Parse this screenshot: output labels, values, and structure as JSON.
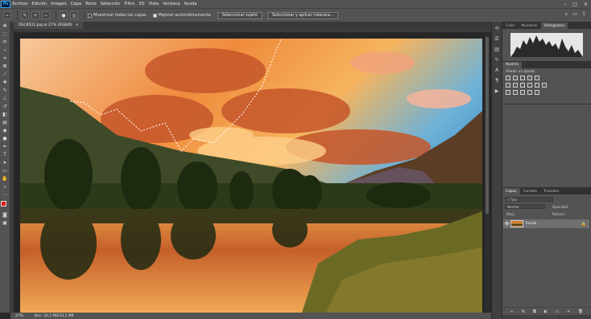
{
  "app": {
    "logo": "Ps"
  },
  "menu": [
    "Archivo",
    "Edición",
    "Imagen",
    "Capa",
    "Texto",
    "Selección",
    "Filtro",
    "3D",
    "Vista",
    "Ventana",
    "Ayuda"
  ],
  "window_controls": {
    "minimize": "–",
    "maximize": "□",
    "close": "✕"
  },
  "options": {
    "sample_all_layers": "Muestrear todas las capas",
    "auto_enhance": "Mejorar automáticamente",
    "select_subject": "Seleccionar sujeto",
    "select_and_mask": "Seleccionar y aplicar máscara..."
  },
  "document": {
    "tab": "DSC8522.jpg al 27% (RGB/8)",
    "tab_close": "×"
  },
  "status": {
    "zoom": "27%",
    "doc_size": "Doc: 33,1 MB/33,1 MB"
  },
  "panels": {
    "top_tabs": [
      "Color",
      "Muestras",
      "Histograma"
    ],
    "adjust_tab": "Ajustes",
    "adjust_label": "Añadir un ajuste",
    "layer_tabs": [
      "Capas",
      "Canales",
      "Trazados"
    ],
    "search_placeholder": "Tipo",
    "blend_mode": "Normal",
    "opacity_label": "Opacidad:",
    "fill_label": "Relleno:",
    "lock_label": "Bloq.:",
    "layer_name": "Fondo",
    "eye": "👁",
    "lock": "🔒"
  },
  "colors": {
    "foreground": "#e31b1b",
    "background": "#000000",
    "accent": "#31a8ff"
  }
}
